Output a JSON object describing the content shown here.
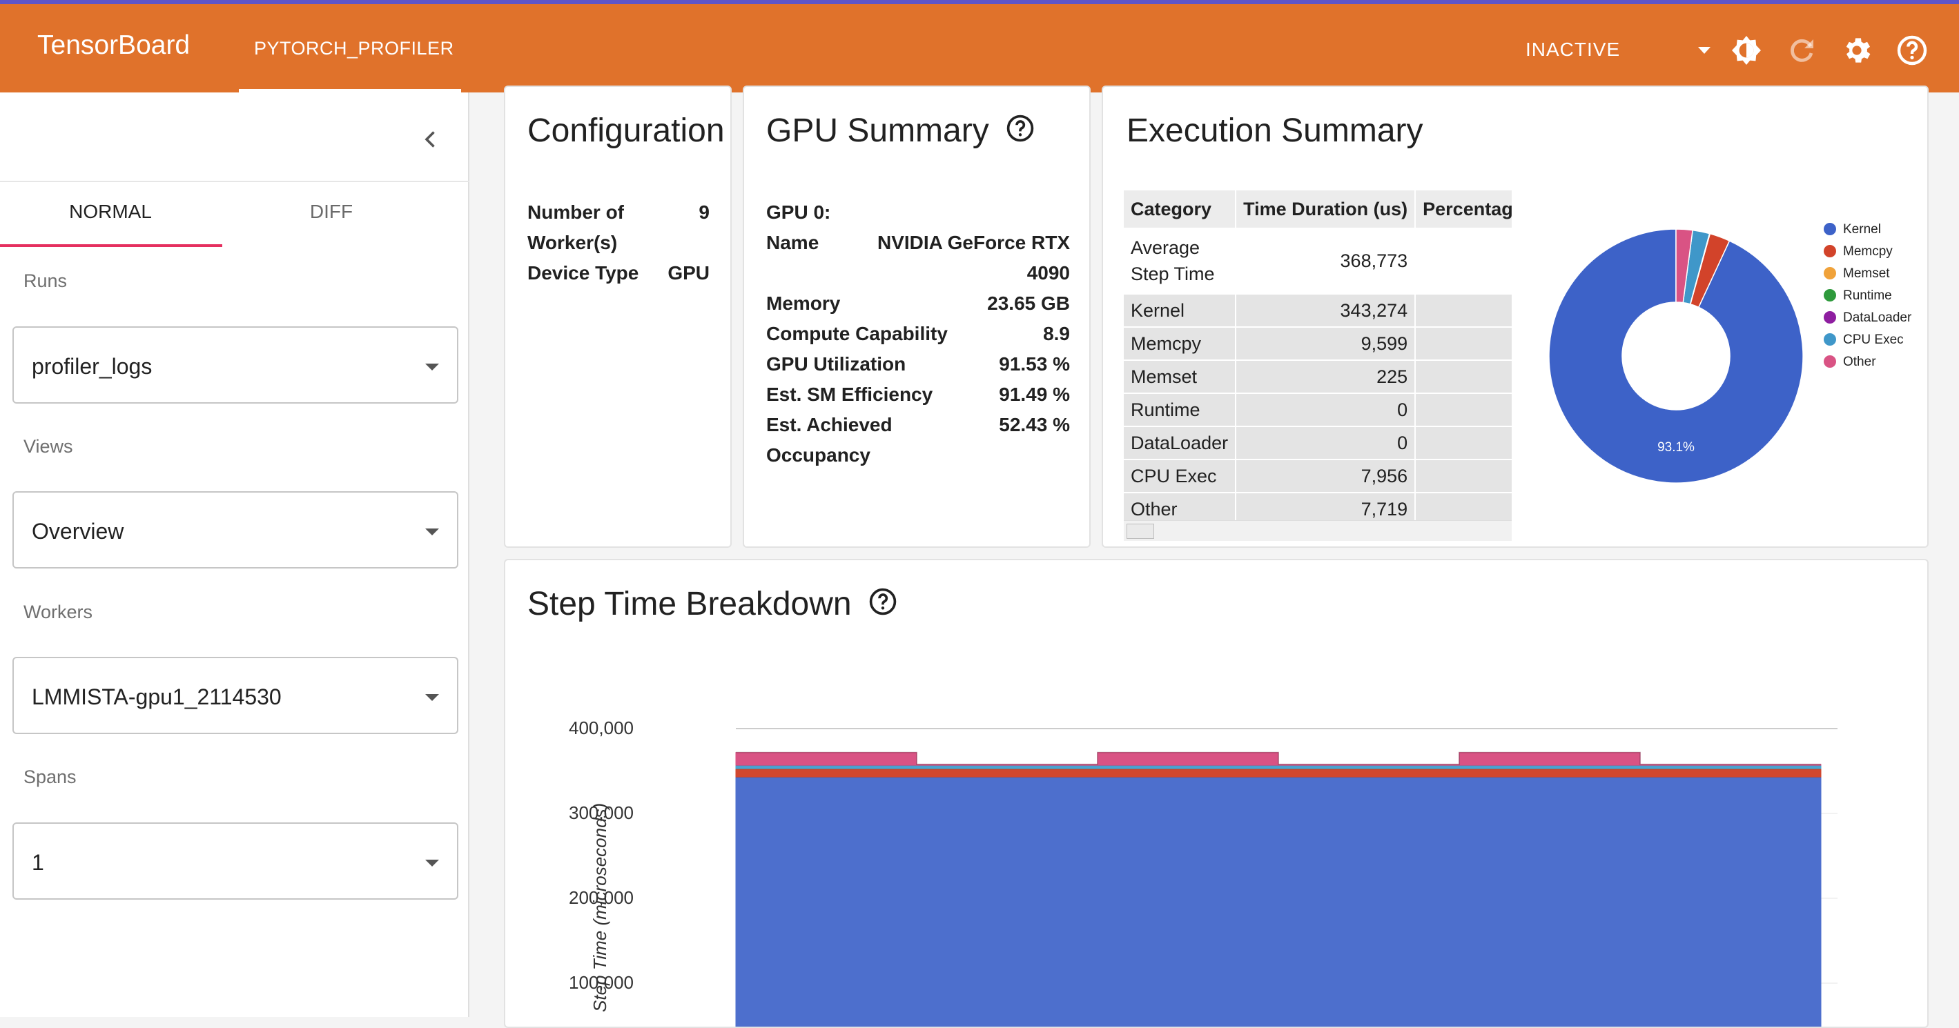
{
  "header": {
    "brand": "TensorBoard",
    "active_tab": "PYTORCH_PROFILER",
    "status": "INACTIVE",
    "icons": [
      "brightness-icon",
      "refresh-icon",
      "settings-gear-icon",
      "help-icon"
    ]
  },
  "sidebar": {
    "tabs": [
      "NORMAL",
      "DIFF"
    ],
    "active_tab": "NORMAL",
    "fields": [
      {
        "label": "Runs",
        "value": "profiler_logs"
      },
      {
        "label": "Views",
        "value": "Overview"
      },
      {
        "label": "Workers",
        "value": "LMMISTA-gpu1_2114530"
      },
      {
        "label": "Spans",
        "value": "1"
      }
    ]
  },
  "configuration": {
    "title": "Configuration",
    "rows": [
      {
        "label": "Number of Worker(s)",
        "label_lines": [
          "Number of",
          "Worker(s)"
        ],
        "value": "9"
      },
      {
        "label": "Device Type",
        "value": "GPU"
      }
    ]
  },
  "gpu_summary": {
    "title": "GPU Summary",
    "gpu_label": "GPU 0:",
    "name_label": "Name",
    "name_value_lines": [
      "NVIDIA GeForce RTX",
      "4090"
    ],
    "rows": [
      {
        "label": "Memory",
        "value": "23.65 GB"
      },
      {
        "label": "Compute Capability",
        "value": "8.9"
      },
      {
        "label": "GPU Utilization",
        "value": "91.53 %"
      },
      {
        "label": "Est. SM Efficiency",
        "value": "91.49 %"
      },
      {
        "label": "Est. Achieved Occupancy",
        "label_lines": [
          "Est. Achieved",
          "Occupancy"
        ],
        "value": "52.43 %"
      }
    ]
  },
  "execution_summary": {
    "title": "Execution Summary",
    "columns": [
      "Category",
      "Time Duration (us)",
      "Percentag"
    ],
    "first_row": {
      "category_lines": [
        "Average",
        "Step Time"
      ],
      "duration": "368,773"
    },
    "rows": [
      {
        "category": "Kernel",
        "duration": "343,274"
      },
      {
        "category": "Memcpy",
        "duration": "9,599"
      },
      {
        "category": "Memset",
        "duration": "225"
      },
      {
        "category": "Runtime",
        "duration": "0"
      },
      {
        "category": "DataLoader",
        "duration": "0"
      },
      {
        "category": "CPU Exec",
        "duration": "7,956"
      },
      {
        "category": "Other",
        "duration": "7,719"
      }
    ],
    "pie_label": "93.1%",
    "legend": [
      {
        "name": "Kernel",
        "color": "#3d62c8"
      },
      {
        "name": "Memcpy",
        "color": "#d2432a"
      },
      {
        "name": "Memset",
        "color": "#f0a23a"
      },
      {
        "name": "Runtime",
        "color": "#2e9a3c"
      },
      {
        "name": "DataLoader",
        "color": "#8e1ea0"
      },
      {
        "name": "CPU Exec",
        "color": "#3f97c9"
      },
      {
        "name": "Other",
        "color": "#d95384"
      }
    ]
  },
  "step_time": {
    "title": "Step Time Breakdown",
    "y_title": "Step Time (microseconds)",
    "y_ticks": [
      "400,000",
      "300,000",
      "200,000",
      "100,000"
    ]
  },
  "chart_data": [
    {
      "type": "pie",
      "title": "",
      "labels": [
        "Kernel",
        "Memcpy",
        "Memset",
        "Runtime",
        "DataLoader",
        "CPU Exec",
        "Other"
      ],
      "values": [
        343274,
        9599,
        225,
        0,
        0,
        7956,
        7719
      ],
      "data_labels": [
        "93.1%"
      ],
      "legend_position": "right"
    },
    {
      "type": "area",
      "title": "Step Time Breakdown",
      "ylabel": "Step Time (microseconds)",
      "ylim": [
        0,
        400000
      ],
      "x": [
        1,
        2,
        3,
        4,
        5,
        6
      ],
      "series": [
        {
          "name": "Kernel",
          "color": "#4d6fcd",
          "values": [
            343000,
            343000,
            343000,
            343000,
            343000,
            343000
          ]
        },
        {
          "name": "Memcpy",
          "color": "#d0472f",
          "values": [
            9600,
            9600,
            9600,
            9600,
            9600,
            9600
          ]
        },
        {
          "name": "Memset",
          "color": "#f0a23a",
          "values": [
            225,
            225,
            225,
            225,
            225,
            225
          ]
        },
        {
          "name": "CPU Exec",
          "color": "#49a3d2",
          "values": [
            4000,
            4000,
            4000,
            4000,
            4000,
            4000
          ]
        },
        {
          "name": "Other",
          "color": "#d95384",
          "values": [
            15000,
            1000,
            15000,
            1000,
            15000,
            1000
          ]
        }
      ]
    }
  ]
}
